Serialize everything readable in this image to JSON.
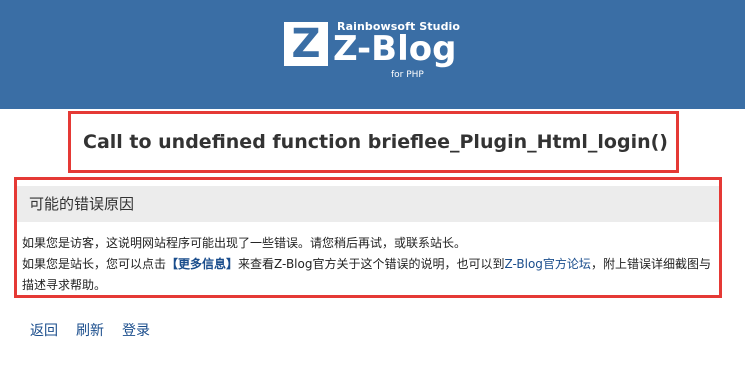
{
  "header": {
    "logo_letter": "Z",
    "studio": "Rainbowsoft Studio",
    "brand": "Z-Blog",
    "sub": "for PHP"
  },
  "error": {
    "title": "Call to undefined function brieflee_Plugin_Html_login()"
  },
  "reason": {
    "heading": "可能的错误原因",
    "visitor_line": "如果您是访客，这说明网站程序可能出现了一些错误。请您稍后再试，或联系站长。",
    "admin_prefix": "如果您是站长，您可以点击",
    "more_info_link": "【更多信息】",
    "admin_middle": "来查看Z-Blog官方关于这个错误的说明，也可以到",
    "forum_link": "Z-Blog官方论坛",
    "admin_suffix": "，附上错误详细截图与描述寻求帮助。"
  },
  "footer": {
    "back": "返回",
    "refresh": "刷新",
    "login": "登录"
  },
  "colors": {
    "header_bg": "#3a6ea5",
    "highlight_border": "#e53935",
    "link": "#1a4d8c"
  }
}
